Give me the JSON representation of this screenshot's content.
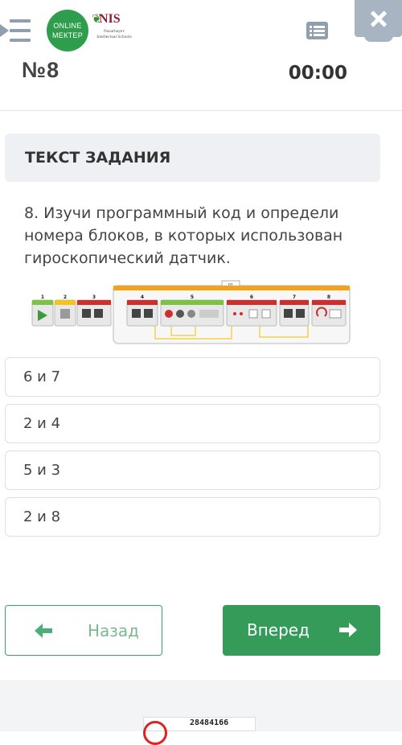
{
  "header": {
    "logo_line1": "ONLINE",
    "logo_line2": "МЕКТЕР",
    "nis_brand": "NIS",
    "nis_subtitle": "Nazarbayev Intellectual Schools",
    "question_number": "№8",
    "timer": "00:00"
  },
  "task": {
    "heading": "ТЕКСТ ЗАДАНИЯ",
    "text": "8. Изучи программный код и определи номера блоков, в которых использован гироскопический датчик."
  },
  "program_figure": {
    "loop_label": "01",
    "block_numbers": [
      "1",
      "2",
      "3",
      "4",
      "5",
      "6",
      "7",
      "8"
    ]
  },
  "answers": [
    "6 и 7",
    "2 и 4",
    "5 и 3",
    "2 и 8"
  ],
  "navigation": {
    "back_label": "Назад",
    "forward_label": "Вперед"
  },
  "footer": {
    "code": "28484166"
  },
  "colors": {
    "primary_green": "#349b58",
    "icon_gray": "#8f9fb0",
    "close_bg": "#a8b4c2"
  }
}
